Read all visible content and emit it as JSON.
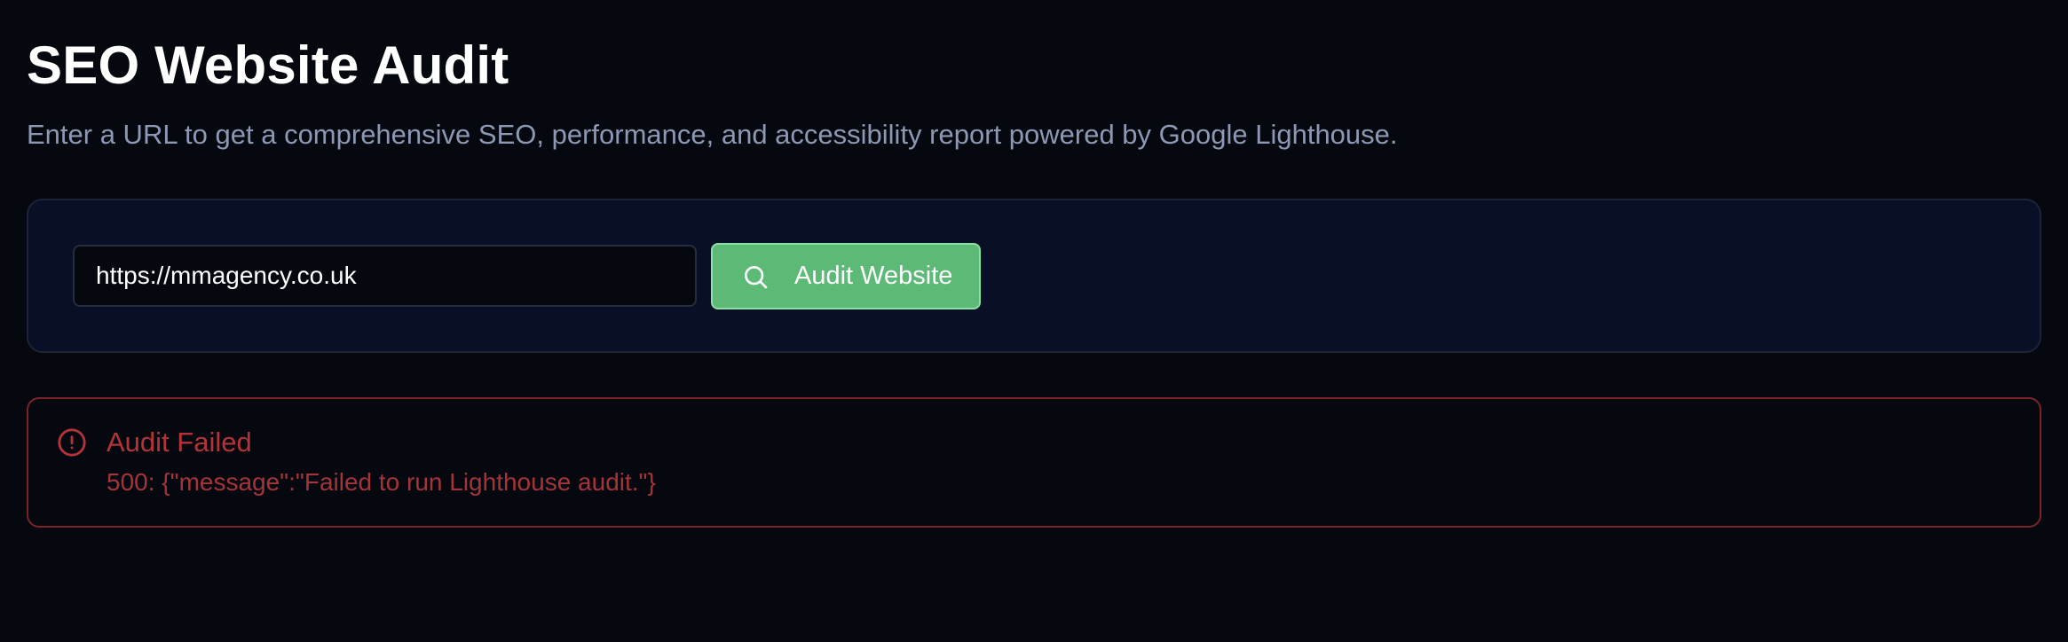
{
  "header": {
    "title": "SEO Website Audit",
    "subtitle": "Enter a URL to get a comprehensive SEO, performance, and accessibility report powered by Google Lighthouse."
  },
  "audit_form": {
    "url_value": "https://mmagency.co.uk",
    "button_label": "Audit Website",
    "button_icon": "search-icon"
  },
  "error": {
    "icon": "alert-circle-icon",
    "title": "Audit Failed",
    "message": "500: {\"message\":\"Failed to run Lighthouse audit.\"}"
  },
  "colors": {
    "background": "#05080f",
    "card_background": "#0a0f28",
    "accent_green": "#5cba76",
    "error_red": "#b3333a",
    "subtitle_text": "#8d98b4"
  }
}
